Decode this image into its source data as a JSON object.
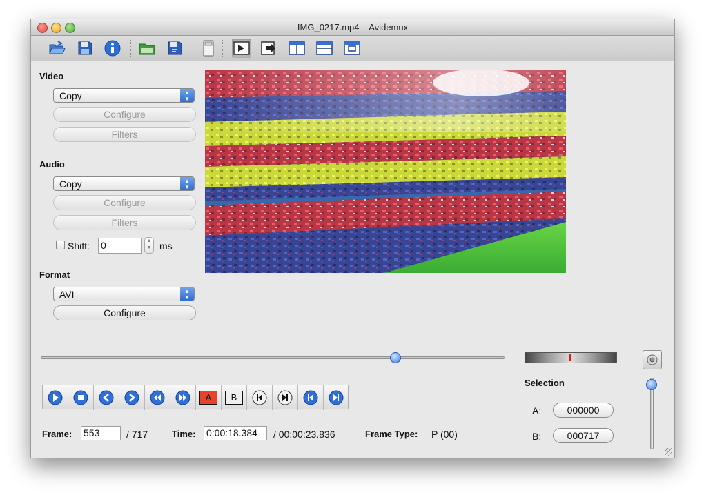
{
  "window": {
    "title": "IMG_0217.mp4 – Avidemux"
  },
  "toolbar": {
    "buttons": [
      {
        "name": "open-icon"
      },
      {
        "name": "save-icon"
      },
      {
        "name": "info-icon"
      },
      {
        "name": "open-folder-icon"
      },
      {
        "name": "save-as-icon"
      },
      {
        "name": "calculator-icon"
      },
      {
        "name": "video-output-icon"
      },
      {
        "name": "output-arrow-icon"
      },
      {
        "name": "split-vertical-icon"
      },
      {
        "name": "split-horizontal-icon"
      },
      {
        "name": "display-frame-icon"
      }
    ]
  },
  "video": {
    "heading": "Video",
    "codec": "Copy",
    "configure_label": "Configure",
    "filters_label": "Filters"
  },
  "audio": {
    "heading": "Audio",
    "codec": "Copy",
    "configure_label": "Configure",
    "filters_label": "Filters",
    "shift_label": "Shift:",
    "shift_value": "0",
    "shift_unit": "ms"
  },
  "format": {
    "heading": "Format",
    "container": "AVI",
    "configure_label": "Configure"
  },
  "timeline": {
    "position": 0.765
  },
  "controls": {
    "buttons": [
      {
        "name": "play-icon"
      },
      {
        "name": "stop-icon"
      },
      {
        "name": "previous-frame-icon"
      },
      {
        "name": "next-frame-icon"
      },
      {
        "name": "previous-keyframe-icon"
      },
      {
        "name": "next-keyframe-icon"
      },
      {
        "name": "set-marker-a-icon",
        "text": "A"
      },
      {
        "name": "set-marker-b-icon",
        "text": "B"
      },
      {
        "name": "goto-marker-a-icon"
      },
      {
        "name": "goto-marker-b-icon"
      },
      {
        "name": "previous-black-frame-icon"
      },
      {
        "name": "next-black-frame-icon"
      }
    ]
  },
  "status": {
    "frame_label": "Frame:",
    "frame_value": "553",
    "frame_total": "/ 717",
    "time_label": "Time:",
    "time_value": "0:00:18.384",
    "time_total": "/ 00:00:23.836",
    "frame_type_label": "Frame Type:",
    "frame_type_value": "P (00)"
  },
  "selection": {
    "heading": "Selection",
    "a_label": "A:",
    "a_value": "000000",
    "b_label": "B:",
    "b_value": "000717"
  },
  "volume": {
    "level": 0.9
  }
}
